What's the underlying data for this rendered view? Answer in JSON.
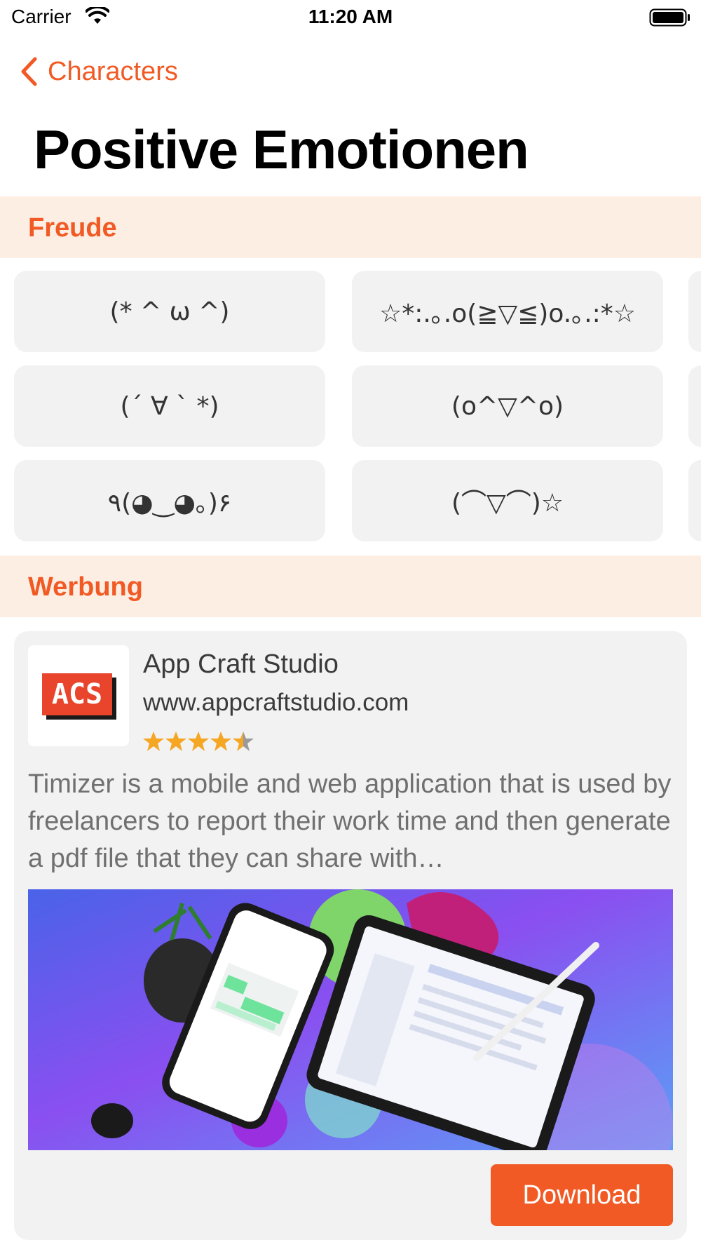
{
  "status_bar": {
    "carrier": "Carrier",
    "time": "11:20 AM"
  },
  "nav": {
    "back_label": "Characters"
  },
  "page": {
    "title": "Positive Emotionen"
  },
  "sections": [
    {
      "title": "Freude",
      "items": [
        "(* ^ ω ^)",
        "☆*:.｡.o(≧▽≦)o.｡.:*☆",
        "(´ ∀ ` *)",
        "(o^▽^o)",
        "٩(◕‿◕｡)۶",
        "(⌒▽⌒)☆"
      ]
    },
    {
      "title": "Werbung"
    }
  ],
  "ad": {
    "logo_text": "ACS",
    "name": "App Craft Studio",
    "url": "www.appcraftstudio.com",
    "rating": 4.5,
    "description": "Timizer is a mobile and web application that is used by freelancers to report their work time and then generate a pdf file that they can share with…",
    "download_label": "Download"
  },
  "colors": {
    "accent": "#f15a24",
    "section_bg": "#fdeee4",
    "cell_bg": "#f2f2f3"
  },
  "icons": [
    "wifi-icon",
    "battery-icon",
    "chevron-left-icon",
    "star-icon"
  ]
}
